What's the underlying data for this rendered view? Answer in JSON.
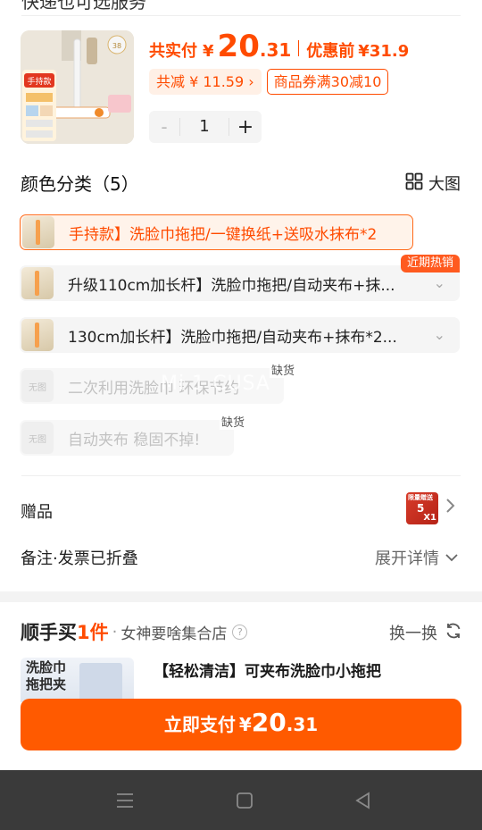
{
  "header": {
    "cut_text": "快递也可选服务"
  },
  "product": {
    "price_label": "共实付",
    "currency": "¥",
    "price_int": "20",
    "price_dec": ".31",
    "orig_label": "优惠前",
    "orig_price": "¥31.9",
    "saved": "共减 ¥ 11.59 ›",
    "coupon": "商品券满30减10",
    "quantity": "1",
    "minus": "-",
    "plus": "+"
  },
  "variants": {
    "title": "颜色分类（5）",
    "big_image_label": "大图",
    "options": [
      {
        "text": "手持款】洗脸巾拖把/一键换纸+送吸水抹布*2",
        "state": "selected"
      },
      {
        "text": "升级110cm加长杆】洗脸巾拖把/自动夹布+抹...",
        "badge": "近期热销"
      },
      {
        "text": "130cm加长杆】洗脸巾拖把/自动夹布+抹布*2..."
      },
      {
        "text": "二次利用洗脸巾 环保节约",
        "oos": "缺货",
        "thumb": "无图"
      },
      {
        "text": "自动夹布 稳固不掉!",
        "oos": "缺货",
        "thumb": "无图"
      }
    ],
    "watermark": "Mi 1 CUSA"
  },
  "gift": {
    "label": "赠品",
    "thumb_top": "限量赠送",
    "thumb_num": "5",
    "thumb_qty": "X1"
  },
  "notes": {
    "label": "备注·发票已折叠",
    "expand": "展开详情"
  },
  "bundle": {
    "brand_prefix": "顺手买",
    "brand_accent": "1件",
    "dot": "·",
    "store": "女神要啥集合店",
    "help": "?",
    "swap": "换一换",
    "thumb_text": "洗脸巾拖把夹",
    "name": "【轻松清洁】可夹布洗脸巾小拖把"
  },
  "pay": {
    "label": "立即支付",
    "currency": "¥",
    "int": "20",
    "dec": ".31"
  },
  "colors": {
    "accent": "#ff5a00",
    "accent_text": "#ff4b00",
    "nav_bg": "#3a3a3a"
  }
}
